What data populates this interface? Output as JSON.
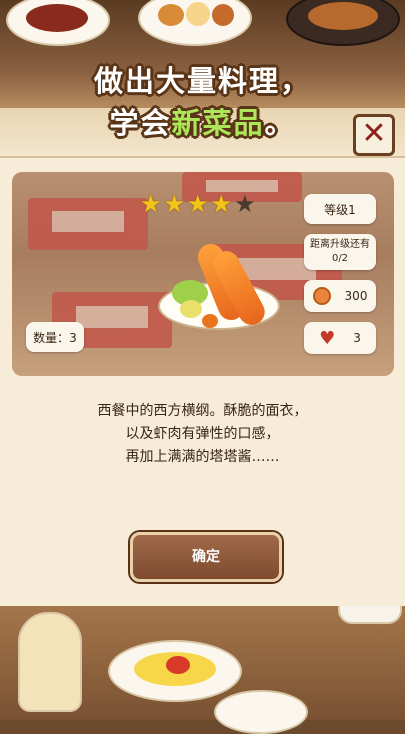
{
  "title": {
    "line1": "做出大量料理，",
    "line2_prefix": "学会",
    "line2_highlight": "新菜品",
    "line2_suffix": "。"
  },
  "close_label": "✕",
  "item": {
    "stars_filled": 4,
    "stars_total": 5,
    "quantity_label": "数量：3",
    "level_label": "等级1",
    "upgrade_line1": "距离升级还有",
    "upgrade_line2": "0/2",
    "coin_value": "300",
    "heart_value": "3"
  },
  "description": {
    "line1": "西餐中的西方横纲。酥脆的面衣，",
    "line2": "以及虾肉有弹性的口感，",
    "line3": "再加上满满的塔塔酱……"
  },
  "confirm_label": "确定",
  "colors": {
    "title_highlight": "#aee65a",
    "star_on": "#f2c417",
    "star_off": "#4a3a2c",
    "button": "#8a553a"
  }
}
